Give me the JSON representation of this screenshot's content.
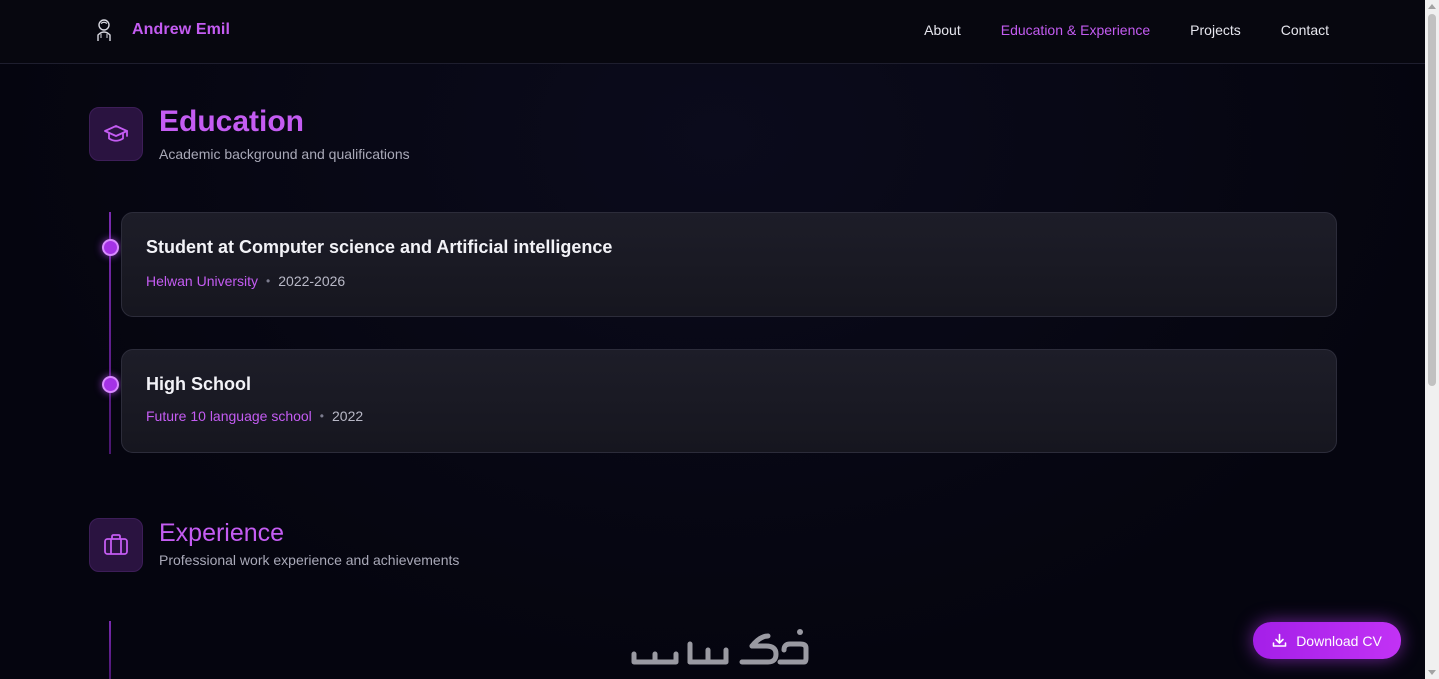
{
  "header": {
    "brand_name": "Andrew Emil",
    "nav": [
      {
        "label": "About",
        "active": false
      },
      {
        "label": "Education & Experience",
        "active": true
      },
      {
        "label": "Projects",
        "active": false
      },
      {
        "label": "Contact",
        "active": false
      }
    ]
  },
  "education": {
    "title": "Education",
    "subtitle": "Academic background and qualifications",
    "icon": "graduation-cap-icon",
    "items": [
      {
        "title": "Student at Computer science and Artificial intelligence",
        "organization": "Helwan University",
        "separator": "•",
        "date": "2022-2026"
      },
      {
        "title": "High School",
        "organization": "Future 10 language school",
        "separator": "•",
        "date": "2022"
      }
    ]
  },
  "experience": {
    "title": "Experience",
    "subtitle": "Professional work experience and achievements",
    "icon": "briefcase-icon"
  },
  "download_button": {
    "label": "Download CV",
    "icon": "download-icon"
  },
  "watermark": {
    "icon": "khamsat-logo"
  },
  "colors": {
    "accent": "#c45cf2",
    "background": "#05050f",
    "card": "#1a1a24"
  }
}
